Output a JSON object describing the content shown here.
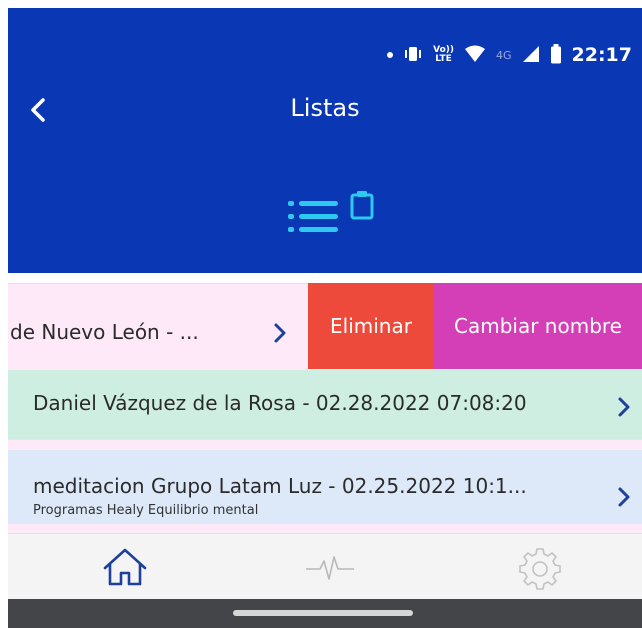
{
  "status_bar": {
    "lte_top": "Vo))",
    "lte_bottom": "LTE",
    "network": "4G",
    "time": "22:17"
  },
  "header": {
    "title": "Listas"
  },
  "list": {
    "row1": {
      "text": "de Nuevo León - ...",
      "delete_label": "Eliminar",
      "rename_label": "Cambiar nombre"
    },
    "row2": {
      "text": "Daniel Vázquez de la Rosa - 02.28.2022 07:08:20"
    },
    "row3": {
      "text": "meditacion Grupo Latam Luz - 02.25.2022 10:1...",
      "subtitle": "Programas Healy Equilibrio mental"
    }
  },
  "tabs": [
    "home-icon",
    "pulse-icon",
    "settings-icon"
  ],
  "colors": {
    "header": "#0a37b3",
    "icon_accent": "#2ec8f2",
    "delete": "#ee4a3b",
    "rename": "#d43fb8",
    "row_pink": "#fde9f7",
    "row_green": "#cdeee0",
    "row_blue": "#dde9f8",
    "tab_active": "#1f3f9d"
  }
}
